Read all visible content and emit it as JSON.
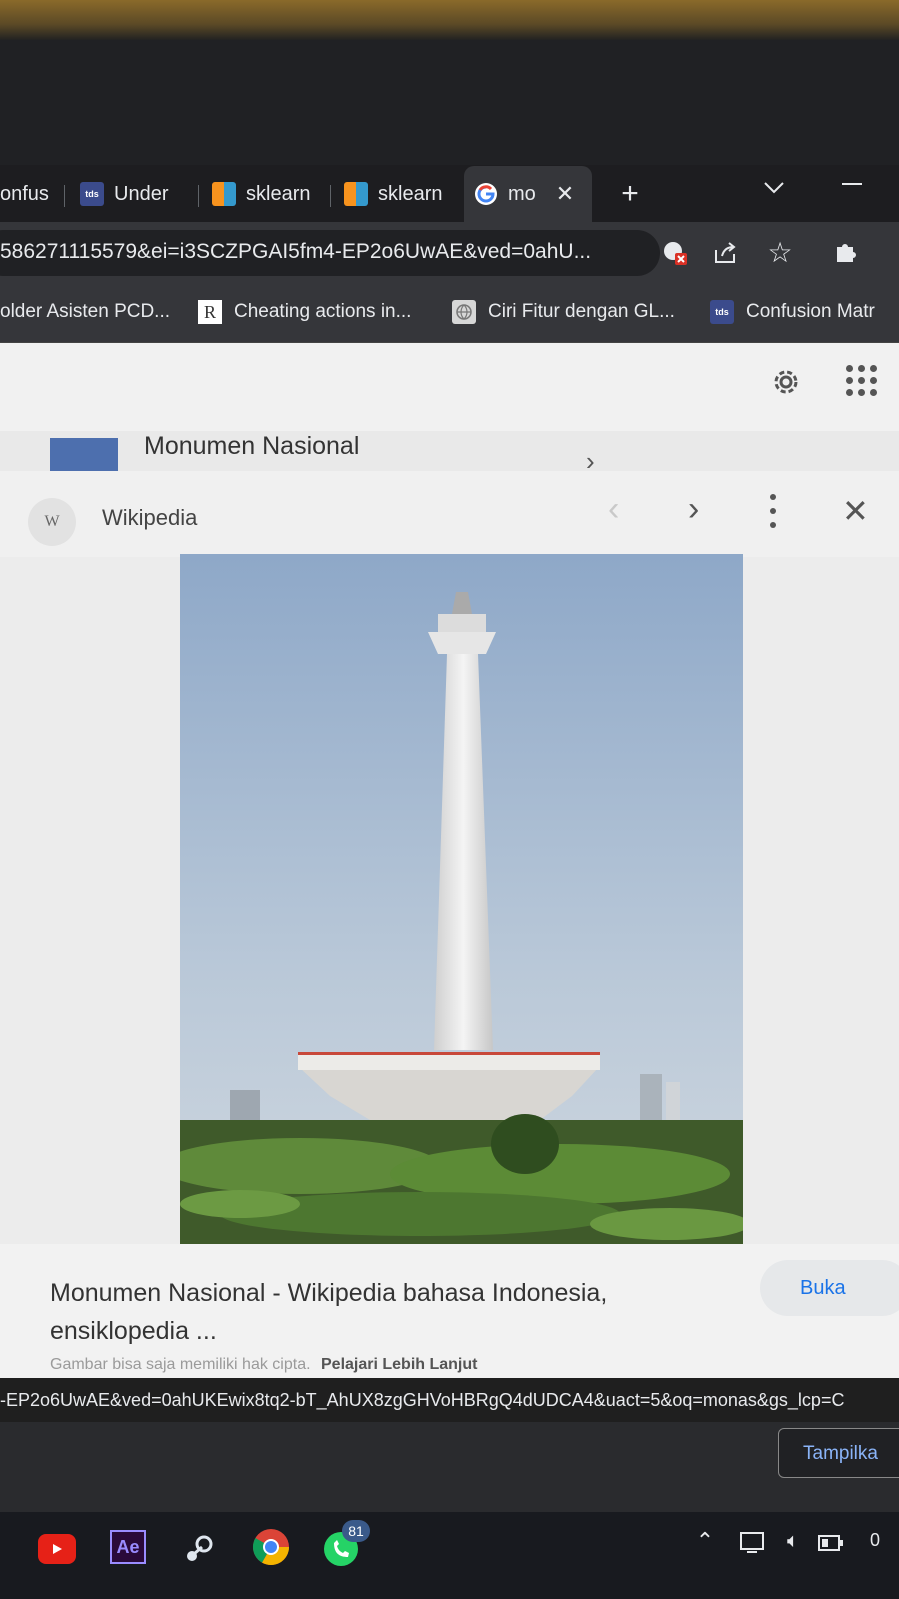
{
  "tabs": [
    {
      "label": "onfus",
      "favicon": "page-icon"
    },
    {
      "label": "Under",
      "favicon": "tds"
    },
    {
      "label": "sklearn",
      "favicon": "sklearn-logo"
    },
    {
      "label": "sklearn",
      "favicon": "sklearn-logo"
    },
    {
      "label": "mo",
      "favicon": "google-logo",
      "active": true
    }
  ],
  "new_tab": "+",
  "address": {
    "url": "586271115579&ei=i3SCZPGAI5fm4-EP2o6UwAE&ved=0ahU..."
  },
  "bookmarks": [
    {
      "label": "older Asisten PCD...",
      "icon": "folder-icon"
    },
    {
      "label": "Cheating actions in...",
      "icon": "researchgate-icon",
      "icon_text": "R"
    },
    {
      "label": "Ciri Fitur dengan GL...",
      "icon": "globe-icon"
    },
    {
      "label": "Confusion Matr",
      "icon": "tds-icon",
      "icon_text": "tds"
    }
  ],
  "result": {
    "title": "Monumen Nasional"
  },
  "panel": {
    "source_letter": "W",
    "source": "Wikipedia",
    "caption": "Monumen Nasional - Wikipedia bahasa Indonesia, ensiklopedia ...",
    "open_button": "Buka",
    "copyright_text": "Gambar bisa saja memiliki hak cipta.",
    "learn_more": "Pelajari Lebih Lanjut"
  },
  "status_bar": {
    "url": "-EP2o6UwAE&ved=0ahUKEwix8tq2-bT_AhUX8zgGHVoHBRgQ4dUDCA4&uact=5&oq=monas&gs_lcp=C"
  },
  "show_button": "Tampilka",
  "taskbar": {
    "ae_label": "Ae",
    "whatsapp_badge": "81",
    "clock": "0"
  },
  "colors": {
    "accent": "#1a73e8",
    "chrome_dark": "#202124",
    "chrome_mid": "#35363a"
  }
}
